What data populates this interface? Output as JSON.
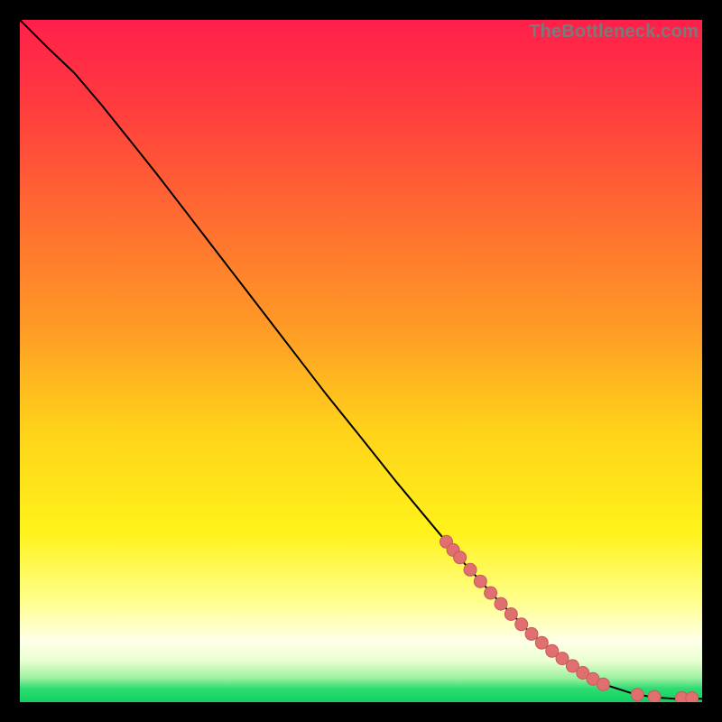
{
  "watermark": "TheBottleneck.com",
  "colors": {
    "grad_top": "#ff1f4b",
    "grad_mid_orange": "#ff8b2a",
    "grad_yellow": "#ffe11a",
    "grad_pale_yellow": "#ffff9a",
    "grad_white": "#ffffff",
    "grad_green": "#10e06a",
    "curve_stroke": "#000000",
    "marker_fill": "#e07070",
    "marker_stroke": "#c85a5a"
  },
  "chart_data": {
    "type": "line",
    "title": "",
    "xlabel": "",
    "ylabel": "",
    "xlim": [
      0,
      100
    ],
    "ylim": [
      0,
      100
    ],
    "curve": [
      {
        "x": 0,
        "y": 100
      },
      {
        "x": 4,
        "y": 96
      },
      {
        "x": 8,
        "y": 92.2
      },
      {
        "x": 12,
        "y": 87.5
      },
      {
        "x": 16,
        "y": 82.5
      },
      {
        "x": 20,
        "y": 77.5
      },
      {
        "x": 25,
        "y": 71
      },
      {
        "x": 30,
        "y": 64.5
      },
      {
        "x": 35,
        "y": 58
      },
      {
        "x": 40,
        "y": 51.5
      },
      {
        "x": 45,
        "y": 45
      },
      {
        "x": 50,
        "y": 38.8
      },
      {
        "x": 55,
        "y": 32.5
      },
      {
        "x": 60,
        "y": 26.5
      },
      {
        "x": 65,
        "y": 20.5
      },
      {
        "x": 70,
        "y": 15
      },
      {
        "x": 75,
        "y": 10
      },
      {
        "x": 80,
        "y": 6
      },
      {
        "x": 85,
        "y": 2.8
      },
      {
        "x": 90,
        "y": 1.2
      },
      {
        "x": 93,
        "y": 0.7
      },
      {
        "x": 96,
        "y": 0.5
      },
      {
        "x": 100,
        "y": 0.5
      }
    ],
    "markers": [
      {
        "x": 62.5,
        "y": 23.5
      },
      {
        "x": 63.5,
        "y": 22.3
      },
      {
        "x": 64.5,
        "y": 21.2
      },
      {
        "x": 66,
        "y": 19.4
      },
      {
        "x": 67.5,
        "y": 17.7
      },
      {
        "x": 69,
        "y": 16.0
      },
      {
        "x": 70.5,
        "y": 14.4
      },
      {
        "x": 72,
        "y": 12.9
      },
      {
        "x": 73.5,
        "y": 11.4
      },
      {
        "x": 75,
        "y": 10.0
      },
      {
        "x": 76.5,
        "y": 8.7
      },
      {
        "x": 78,
        "y": 7.5
      },
      {
        "x": 79.5,
        "y": 6.4
      },
      {
        "x": 81,
        "y": 5.3
      },
      {
        "x": 82.5,
        "y": 4.3
      },
      {
        "x": 84,
        "y": 3.4
      },
      {
        "x": 85.5,
        "y": 2.6
      },
      {
        "x": 90.5,
        "y": 1.1
      },
      {
        "x": 93,
        "y": 0.8
      },
      {
        "x": 97,
        "y": 0.6
      },
      {
        "x": 98.5,
        "y": 0.6
      }
    ]
  }
}
